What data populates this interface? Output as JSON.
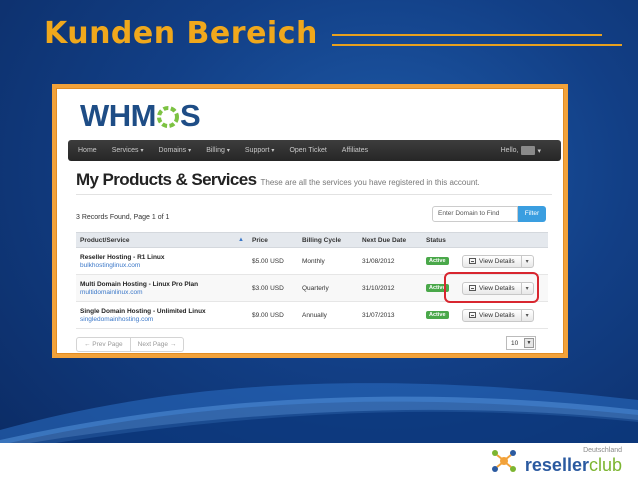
{
  "slide": {
    "title": "Kunden Bereich"
  },
  "footer": {
    "logo_sub": "Deutschland",
    "logo_main": "reseller",
    "logo_accent": "club"
  },
  "app": {
    "logo": {
      "part1": "WHM",
      "part2": "S"
    },
    "nav": {
      "items": [
        "Home",
        "Services",
        "Domains",
        "Billing",
        "Support",
        "Open Ticket",
        "Affiliates"
      ],
      "dropdown_items": [
        "Services",
        "Domains",
        "Billing",
        "Support"
      ],
      "hello": "Hello,"
    },
    "page": {
      "title": "My Products & Services",
      "description": "These are all the services you have registered in this account."
    },
    "records_text": "3 Records Found, Page 1 of 1",
    "search": {
      "placeholder": "Enter Domain to Find",
      "button": "Filter"
    },
    "table": {
      "headers": [
        "Product/Service",
        "Price",
        "Billing Cycle",
        "Next Due Date",
        "Status",
        ""
      ],
      "rows": [
        {
          "name": "Reseller Hosting - R1 Linux",
          "domain": "bulkhostinglinux.com",
          "price": "$5.00 USD",
          "cycle": "Monthly",
          "due": "31/08/2012",
          "status": "Active",
          "action": "View Details"
        },
        {
          "name": "Multi Domain Hosting - Linux Pro Plan",
          "domain": "multidomainlinux.com",
          "price": "$3.00 USD",
          "cycle": "Quarterly",
          "due": "31/10/2012",
          "status": "Active",
          "action": "View Details"
        },
        {
          "name": "Single Domain Hosting - Unlimited Linux",
          "domain": "singledomainhosting.com",
          "price": "$9.00 USD",
          "cycle": "Annually",
          "due": "31/07/2013",
          "status": "Active",
          "action": "View Details"
        }
      ]
    },
    "pagination": {
      "prev": "← Prev Page",
      "next": "Next Page →"
    },
    "per_page": "10",
    "colors": {
      "accent_orange": "#f2a23a",
      "highlight_red": "#d8262f",
      "status_green": "#4aa84a",
      "link_blue": "#3a77c8",
      "title_gold": "#f0a81c"
    }
  }
}
